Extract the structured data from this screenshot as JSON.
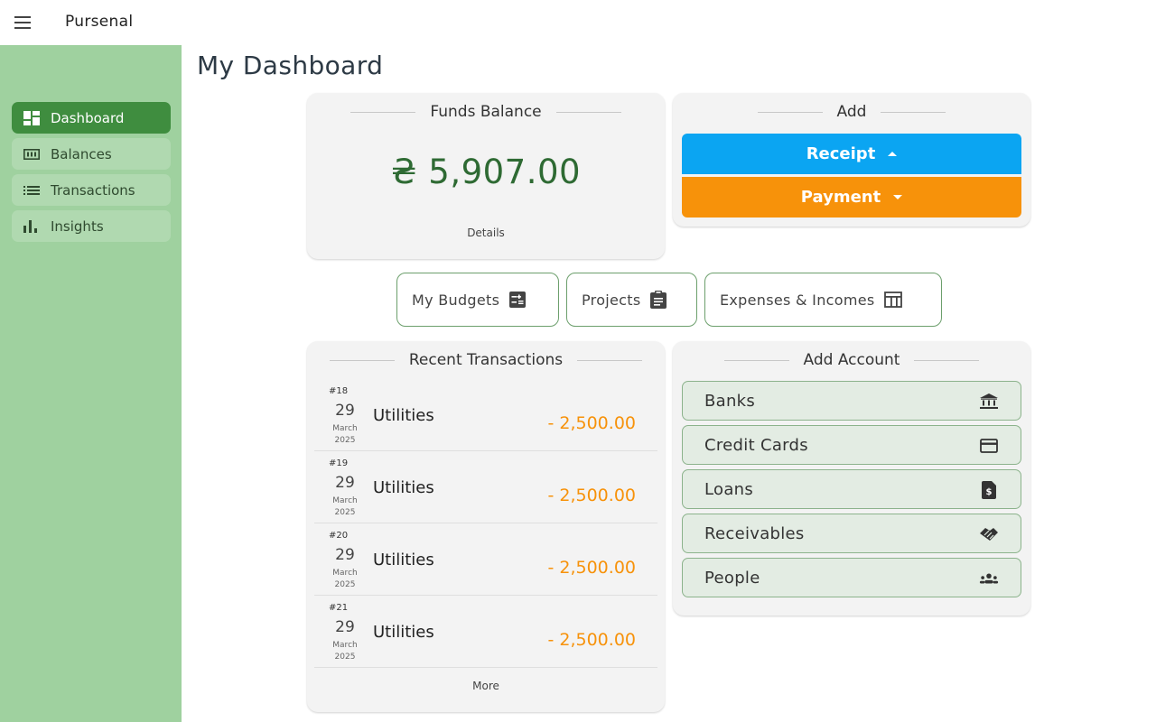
{
  "app": {
    "title": "Pursenal"
  },
  "sidebar": {
    "items": [
      {
        "label": "Dashboard",
        "icon": "dashboard-icon",
        "active": true
      },
      {
        "label": "Balances",
        "icon": "balances-icon",
        "active": false
      },
      {
        "label": "Transactions",
        "icon": "list-icon",
        "active": false
      },
      {
        "label": "Insights",
        "icon": "bar-chart-icon",
        "active": false
      }
    ]
  },
  "page": {
    "title": "My Dashboard"
  },
  "funds": {
    "title": "Funds Balance",
    "amount": "₴ 5,907.00",
    "details_label": "Details"
  },
  "add": {
    "title": "Add",
    "receipt_label": "Receipt",
    "payment_label": "Payment"
  },
  "shortcuts": [
    {
      "label": "My Budgets",
      "icon": "budget-table-icon"
    },
    {
      "label": "Projects",
      "icon": "clipboard-icon"
    },
    {
      "label": "Expenses & Incomes",
      "icon": "table-icon"
    }
  ],
  "recent": {
    "title": "Recent Transactions",
    "more_label": "More",
    "transactions": [
      {
        "id": "#18",
        "day": "29",
        "month": "March",
        "year": "2025",
        "category": "Utilities",
        "amount": "- 2,500.00"
      },
      {
        "id": "#19",
        "day": "29",
        "month": "March",
        "year": "2025",
        "category": "Utilities",
        "amount": "- 2,500.00"
      },
      {
        "id": "#20",
        "day": "29",
        "month": "March",
        "year": "2025",
        "category": "Utilities",
        "amount": "- 2,500.00"
      },
      {
        "id": "#21",
        "day": "29",
        "month": "March",
        "year": "2025",
        "category": "Utilities",
        "amount": "- 2,500.00"
      }
    ]
  },
  "accounts": {
    "title": "Add Account",
    "items": [
      {
        "label": "Banks",
        "icon": "bank-icon"
      },
      {
        "label": "Credit Cards",
        "icon": "credit-card-icon"
      },
      {
        "label": "Loans",
        "icon": "loan-document-icon"
      },
      {
        "label": "Receivables",
        "icon": "handshake-icon"
      },
      {
        "label": "People",
        "icon": "people-icon"
      }
    ]
  },
  "colors": {
    "sidebar_bg": "#9fd19f",
    "active_nav": "#3f8d3f",
    "funds_amount": "#2e6a33",
    "receipt": "#0ba5f2",
    "payment": "#f7920a",
    "expense_amount": "#f7920a"
  }
}
